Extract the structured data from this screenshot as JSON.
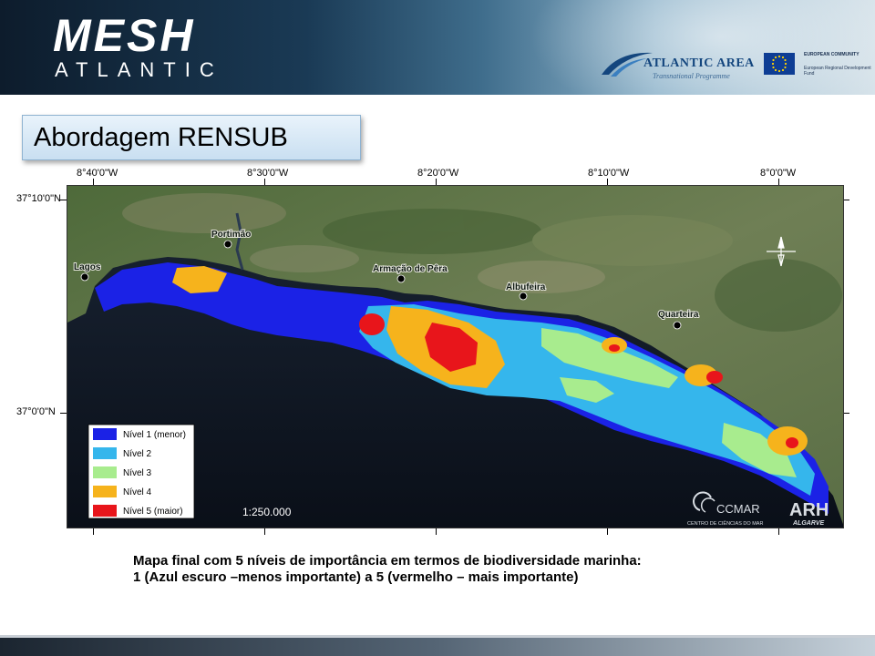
{
  "header": {
    "logo_main": "MESH",
    "logo_sub": "ATLANTIC",
    "partner_name": "ATLANTIC AREA",
    "partner_sub": "Transnational Programme",
    "eu_line1": "EUROPEAN COMMUNITY",
    "eu_line2": "European Regional Development Fund"
  },
  "slide_title": "Abordagem RENSUB",
  "map": {
    "longitudes": [
      "8°40'0\"W",
      "8°30'0\"W",
      "8°20'0\"W",
      "8°10'0\"W",
      "8°0'0\"W"
    ],
    "latitudes": [
      "37°10'0\"N",
      "37°0'0\"N"
    ],
    "places": [
      "Portimão",
      "Lagos",
      "Armação de Pêra",
      "Albufeira",
      "Quarteira"
    ],
    "legend": [
      {
        "label": "Nível 1 (menor)",
        "color": "#1b22e6"
      },
      {
        "label": "Nível 2",
        "color": "#35b6ec"
      },
      {
        "label": "Nível 3",
        "color": "#a8ec8e"
      },
      {
        "label": "Nível 4",
        "color": "#f6b31c"
      },
      {
        "label": "Nível 5 (maior)",
        "color": "#e8151b"
      }
    ],
    "scale": "1:250.000",
    "logo_ccmar": "CCMAR",
    "logo_ccmar_sub": "CENTRO DE CIÊNCIAS DO MAR",
    "logo_arh": "ARH",
    "logo_arh_sub": "ALGARVE"
  },
  "caption": {
    "line1": "Mapa final com 5 níveis de importância em termos de biodiversidade marinha:",
    "line2": "1 (Azul escuro –menos importante) a 5 (vermelho – mais importante)"
  }
}
